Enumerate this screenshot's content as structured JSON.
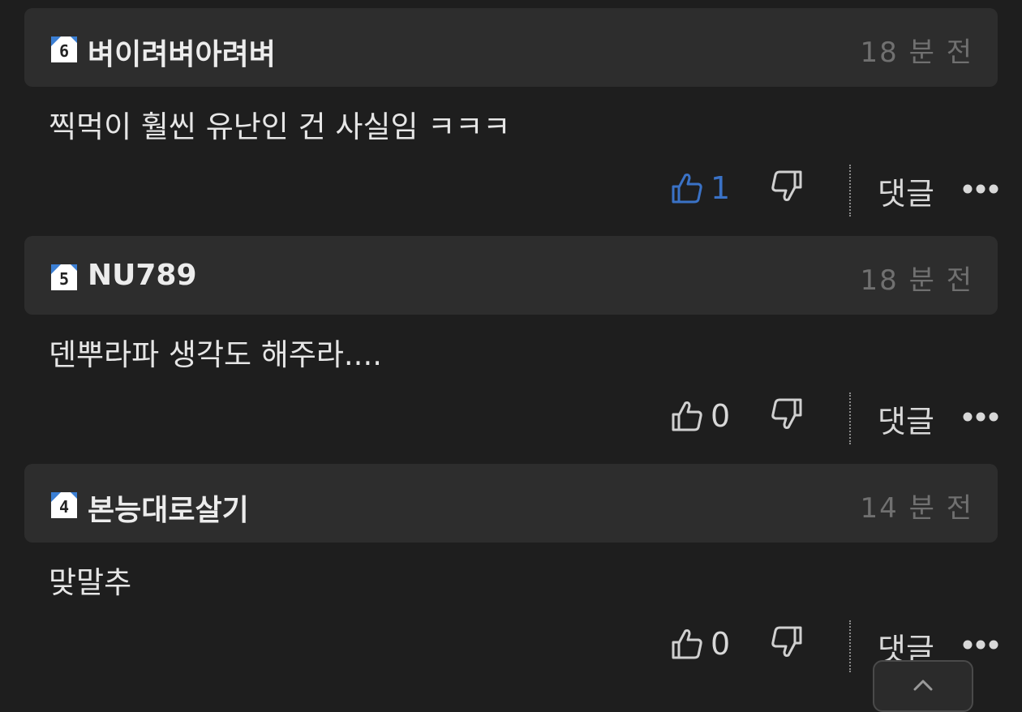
{
  "colors": {
    "background": "#1e1e1e",
    "header_background": "#2d2d2d",
    "liked_accent": "#3a72c6",
    "timestamp": "#707070"
  },
  "comments": [
    {
      "level": "6",
      "username": "벼이려벼아려벼",
      "time": "18 분 전",
      "body": "찍먹이 훨씬 유난인 건 사실임 ㅋㅋㅋ",
      "likes": "1",
      "liked": true,
      "reply_label": "댓글",
      "like_icon": "thumbs-up-icon",
      "dislike_icon": "thumbs-down-icon",
      "more_icon": "more-dots-icon"
    },
    {
      "level": "5",
      "username": "NU789",
      "time": "18 분 전",
      "body": "덴뿌라파 생각도 해주라....",
      "likes": "0",
      "liked": false,
      "reply_label": "댓글",
      "like_icon": "thumbs-up-icon",
      "dislike_icon": "thumbs-down-icon",
      "more_icon": "more-dots-icon"
    },
    {
      "level": "4",
      "username": "본능대로살기",
      "time": "14 분 전",
      "body": "맞말추",
      "likes": "0",
      "liked": false,
      "reply_label": "댓글",
      "like_icon": "thumbs-up-icon",
      "dislike_icon": "thumbs-down-icon",
      "more_icon": "more-dots-icon"
    }
  ],
  "scroll_top_icon": "chevron-up-icon"
}
